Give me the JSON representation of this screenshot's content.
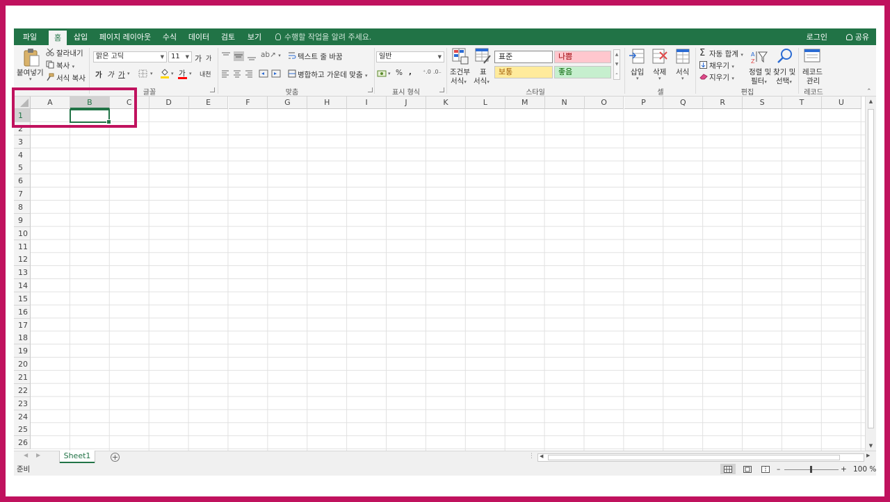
{
  "ribbon_tabs": [
    "파일",
    "홈",
    "삽입",
    "페이지 레이아웃",
    "수식",
    "데이터",
    "검토",
    "보기"
  ],
  "tell_me": "수행할 작업을 알려 주세요.",
  "signin": "로그인",
  "share": "공유",
  "clipboard": {
    "paste": "붙여넣기",
    "cut": "잘라내기",
    "copy": "복사",
    "format_painter": "서식 복사"
  },
  "font": {
    "name": "맑은 고딕",
    "size": "11",
    "grow": "가",
    "shrink": "가",
    "bold": "가",
    "italic": "가",
    "underline": "가",
    "color_letter": "가",
    "phonetic": "내천",
    "group_label": "글꼴"
  },
  "alignment": {
    "wrap_text": "텍스트 줄 바꿈",
    "merge_center": "병합하고 가운데 맞춤",
    "group_label": "맞춤"
  },
  "number": {
    "format": "일반",
    "percent": "%",
    "comma": ",",
    "group_label": "표시 형식"
  },
  "styles": {
    "conditional": [
      "조건부",
      "서식"
    ],
    "format_table": [
      "표",
      "서식"
    ],
    "normal": "표준",
    "bad": "나쁨",
    "neutral": "보통",
    "good": "좋음",
    "group_label": "스타일",
    "colors": {
      "bad_bg": "#ffc7ce",
      "bad_fg": "#9c0006",
      "neutral_bg": "#ffeb9c",
      "neutral_fg": "#9c5700",
      "good_bg": "#c6efce",
      "good_fg": "#006100"
    }
  },
  "cells_group": {
    "insert": "삽입",
    "delete": "삭제",
    "format": "서식",
    "group_label": "셀"
  },
  "editing": {
    "autosum": "자동 합계",
    "fill": "채우기",
    "clear": "지우기",
    "sort_filter": [
      "정렬 및",
      "필터"
    ],
    "find_select": [
      "찾기 및",
      "선택"
    ],
    "group_label": "편집"
  },
  "records": {
    "manage": [
      "레코드",
      "관리"
    ],
    "group_label": "레코드"
  },
  "columns": [
    "A",
    "B",
    "C",
    "D",
    "E",
    "F",
    "G",
    "H",
    "I",
    "J",
    "K",
    "L",
    "M",
    "N",
    "O",
    "P",
    "Q",
    "R",
    "S",
    "T",
    "U"
  ],
  "rows": [
    "1",
    "2",
    "3",
    "4",
    "5",
    "6",
    "7",
    "8",
    "9",
    "10",
    "11",
    "12",
    "13",
    "14",
    "15",
    "16",
    "17",
    "18",
    "19",
    "20",
    "21",
    "22",
    "23",
    "24",
    "25",
    "26"
  ],
  "selected_cell": "B1",
  "sheet_tab": "Sheet1",
  "status": "준비",
  "zoom": "100 %",
  "accent": "#217346",
  "highlight_frame": "#c0125e"
}
